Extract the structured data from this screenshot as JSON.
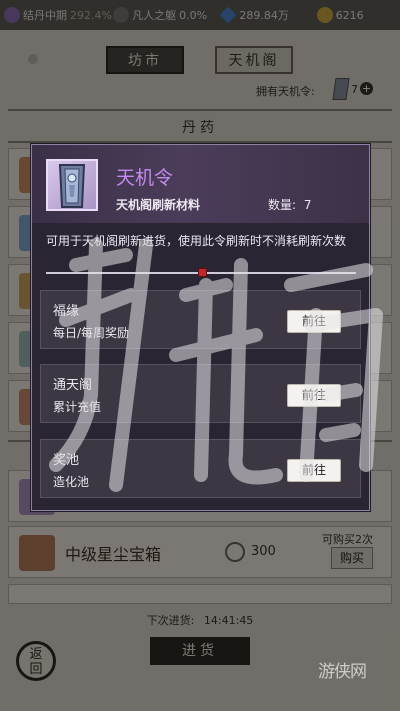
{
  "statusbar": {
    "realm": "结丹中期",
    "realm_progress": "292.4%",
    "body": "凡人之躯",
    "body_progress": "0.0%",
    "spirit_stones": "289.84万",
    "coins": "6216",
    "colors": {
      "bar": "#5e5a55"
    }
  },
  "tabs": {
    "market": "坊市",
    "tianji": "天机阁"
  },
  "owned": {
    "label": "拥有天机令:",
    "count": "7",
    "plus_icon": "plus-icon"
  },
  "section_title": "丹药",
  "shop_rows": [
    {
      "name": "中级星尘宝箱",
      "price": "300",
      "limit": "可购买2次",
      "buy": "购买"
    }
  ],
  "footer": {
    "next_restock_label": "下次进货:",
    "next_restock_time": "14:41:45",
    "restock_button": "进货",
    "back_button": "返回"
  },
  "popup": {
    "item_name": "天机令",
    "item_sub": "天机阁刷新材料",
    "qty_label": "数量:",
    "qty_value": "7",
    "description": "可用于天机阁刷新进货，使用此令刷新时不消耗刷新次数",
    "accent_color": "#c589f0",
    "sources": [
      {
        "title": "福缘",
        "desc": "每日/每周奖励",
        "button": "前往"
      },
      {
        "title": "通天阁",
        "desc": "累计充值",
        "button": "前往"
      },
      {
        "title": "奖池",
        "desc": "造化池",
        "button": "前往"
      }
    ]
  },
  "watermark": {
    "corner_text": "游侠网"
  }
}
